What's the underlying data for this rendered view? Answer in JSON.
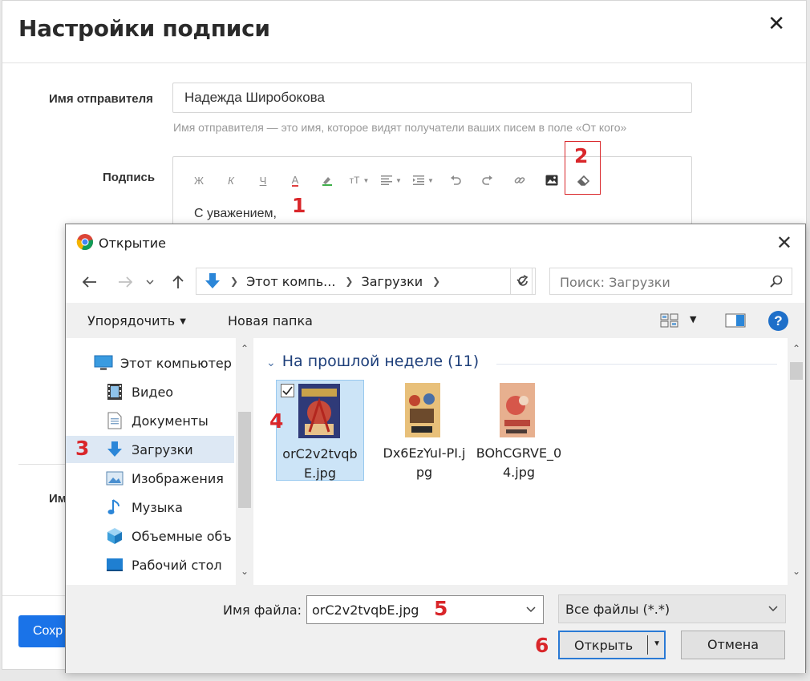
{
  "signature_modal": {
    "title": "Настройки подписи",
    "close_glyph": "✕",
    "sender": {
      "label": "Имя отправителя",
      "value": "Надежда Широбокова",
      "hint": "Имя отправителя — это имя, которое видят получатели ваших писем в поле «От кого»"
    },
    "signature": {
      "label": "Подпись",
      "toolbar": {
        "bold": "Ж",
        "italic": "К",
        "underline": "Ч",
        "text_color": "A",
        "font_size": "тТ"
      },
      "text": "С уважением,"
    },
    "second_name_label_partial": "Им",
    "save_button_partial": "Сохр"
  },
  "annotations": {
    "step1": "1",
    "step2": "2",
    "step3": "3",
    "step4": "4",
    "step5": "5",
    "step6": "6",
    "color": "#d9262a"
  },
  "open_dialog": {
    "title": "Открытие",
    "address": {
      "crumbs": [
        "Этот компь...",
        "Загрузки"
      ]
    },
    "search_placeholder": "Поиск: Загрузки",
    "commands": {
      "organize": "Упорядочить",
      "new_folder": "Новая папка"
    },
    "help_glyph": "?",
    "nav_items": [
      {
        "label": "Этот компьютер",
        "icon": "computer-icon"
      },
      {
        "label": "Видео",
        "icon": "video-icon"
      },
      {
        "label": "Документы",
        "icon": "documents-icon"
      },
      {
        "label": "Загрузки",
        "icon": "downloads-icon",
        "selected": true
      },
      {
        "label": "Изображения",
        "icon": "pictures-icon"
      },
      {
        "label": "Музыка",
        "icon": "music-icon"
      },
      {
        "label": "Объемные объ",
        "icon": "3d-objects-icon"
      },
      {
        "label": "Рабочий стол",
        "icon": "desktop-icon"
      }
    ],
    "group_header": "На прошлой неделе (11)",
    "files": [
      {
        "name": "orC2v2tvqbE.jpg",
        "selected": true,
        "checked": true
      },
      {
        "name": "Dx6EzYuI-PI.jpg",
        "selected": false
      },
      {
        "name": "BOhCGRVE_04.jpg",
        "selected": false
      }
    ],
    "filename_label": "Имя файла:",
    "filename_value": "orC2v2tvqbE.jpg",
    "filetype_value": "Все файлы (*.*)",
    "open_button": "Открыть",
    "cancel_button": "Отмена"
  },
  "colors": {
    "accent_blue": "#1a73e8",
    "selection_blue": "#cce4f7",
    "group_header": "#1e3f7a"
  }
}
